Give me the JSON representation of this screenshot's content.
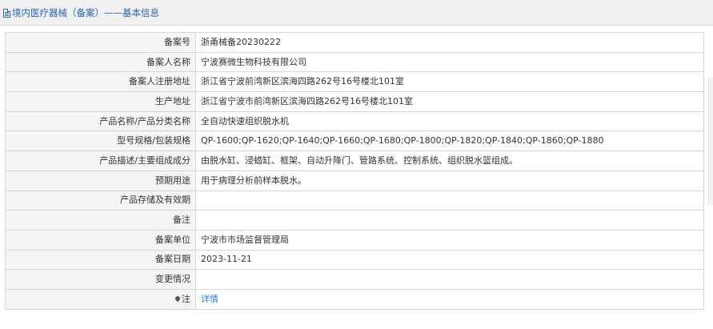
{
  "header": {
    "title": "境内医疗器械（备案）——基本信息",
    "icon": "document-icon"
  },
  "rows": [
    {
      "label": "备案号",
      "value": "浙甬械备20230222"
    },
    {
      "label": "备案人名称",
      "value": "宁波赛微生物科技有限公司"
    },
    {
      "label": "备案人注册地址",
      "value": "浙江省宁波前湾新区滨海四路262号16号楼北101室"
    },
    {
      "label": "生产地址",
      "value": "浙江省宁波市前湾新区滨海四路262号16号楼北101室"
    },
    {
      "label": "产品名称/产品分类名称",
      "value": "全自动快速组织脱水机"
    },
    {
      "label": "型号规格/包装规格",
      "value": "QP-1600;QP-1620;QP-1640;QP-1660;QP-1680;QP-1800;QP-1820;QP-1840;QP-1860;QP-1880"
    },
    {
      "label": "产品描述/主要组成成分",
      "value": "由脱水缸、浸蜡缸、框架、自动升降门、管路系统、控制系统、组织脱水篮组成。"
    },
    {
      "label": "预期用途",
      "value": "用于病理分析前样本脱水。"
    },
    {
      "label": "产品存储及有效期",
      "value": ""
    },
    {
      "label": "备注",
      "value": ""
    },
    {
      "label": "备案单位",
      "value": "宁波市市场监督管理局"
    },
    {
      "label": "备案日期",
      "value": "2023-11-21"
    },
    {
      "label": "变更情况",
      "value": ""
    }
  ],
  "note": {
    "label": "注",
    "icon": "map-pin-icon",
    "link_text": "详情",
    "link_color": "#2f7bd6"
  }
}
